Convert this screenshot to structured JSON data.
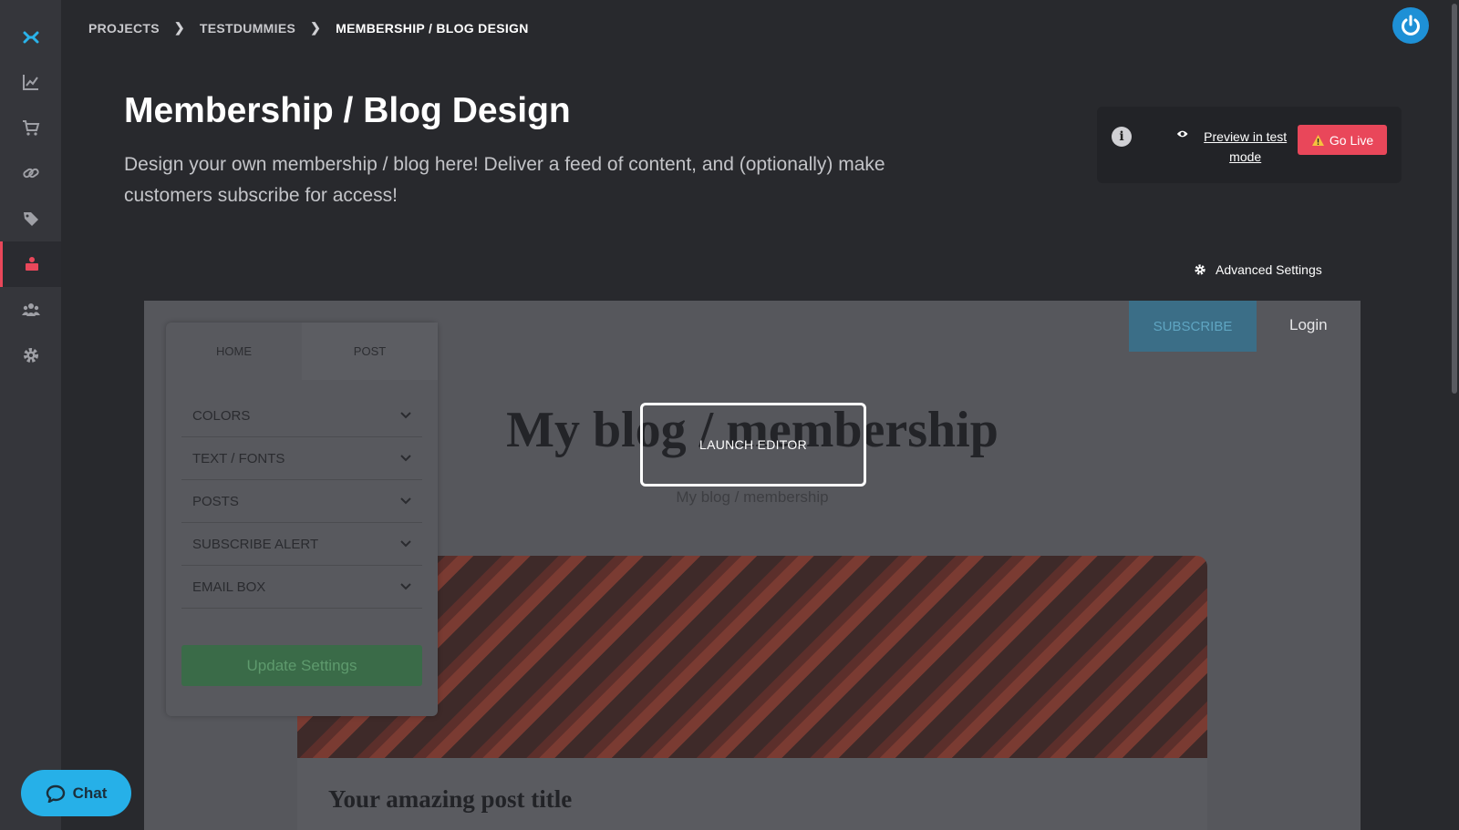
{
  "breadcrumb": {
    "items": [
      "PROJECTS",
      "TESTDUMMIES",
      "MEMBERSHIP / BLOG DESIGN"
    ]
  },
  "page": {
    "title": "Membership / Blog Design",
    "description": "Design your own membership / blog here! Deliver a feed of content, and (optionally) make customers subscribe for access!"
  },
  "actions": {
    "preview_label": "Preview in test mode",
    "go_live_label": "Go Live",
    "advanced_settings_label": "Advanced Settings"
  },
  "sidebar": {
    "items": [
      {
        "icon": "logo-icon"
      },
      {
        "icon": "analytics-icon"
      },
      {
        "icon": "cart-icon"
      },
      {
        "icon": "link-icon"
      },
      {
        "icon": "tags-icon"
      },
      {
        "icon": "membership-icon",
        "active": true
      },
      {
        "icon": "users-icon"
      },
      {
        "icon": "gear-icon"
      }
    ]
  },
  "preview": {
    "subscribe_label": "SUBSCRIBE",
    "login_label": "Login",
    "blog_title": "My blog / membership",
    "blog_subtitle": "My blog / membership",
    "post_title": "Your amazing post title"
  },
  "editor": {
    "tabs": [
      "HOME",
      "POST"
    ],
    "sections": [
      "COLORS",
      "TEXT / FONTS",
      "POSTS",
      "SUBSCRIBE ALERT",
      "EMAIL BOX"
    ],
    "update_label": "Update Settings",
    "launch_label": "LAUNCH EDITOR"
  },
  "chat": {
    "label": "Chat"
  },
  "colors": {
    "accent": "#e9475a",
    "brand_blue": "#26b0e8",
    "background": "#28292d"
  }
}
